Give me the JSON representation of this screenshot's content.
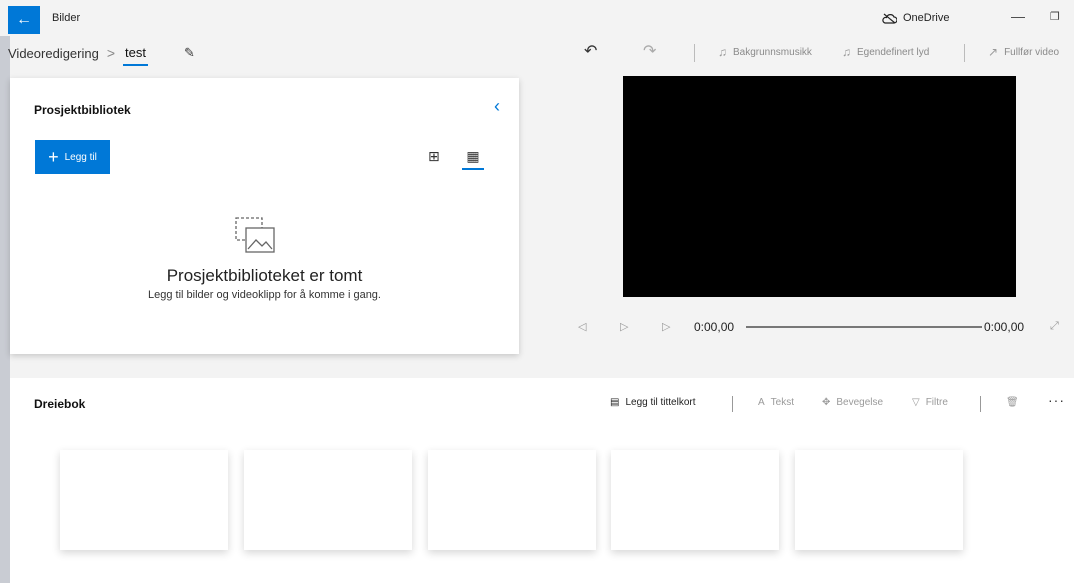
{
  "app": {
    "title": "Bilder",
    "onedrive_label": "OneDrive"
  },
  "breadcrumb": {
    "root": "Videoredigering",
    "separator": ">",
    "current": "test"
  },
  "toolbar": {
    "background_music": "Bakgrunnsmusikk",
    "custom_audio": "Egendefinert lyd",
    "finish_video": "Fullfør video"
  },
  "library": {
    "title": "Prosjektbibliotek",
    "add_label": "Legg til",
    "empty_title": "Prosjektbiblioteket er tomt",
    "empty_subtitle": "Legg til bilder og videoklipp for å komme i gang."
  },
  "player": {
    "time_current": "0:00,00",
    "time_total": "0:00,00"
  },
  "storyboard": {
    "title": "Dreiebok",
    "add_title_card": "Legg til tittelkort",
    "text": "Tekst",
    "motion": "Bevegelse",
    "filters": "Filtre",
    "more": "···"
  },
  "colors": {
    "accent": "#0078d7"
  }
}
